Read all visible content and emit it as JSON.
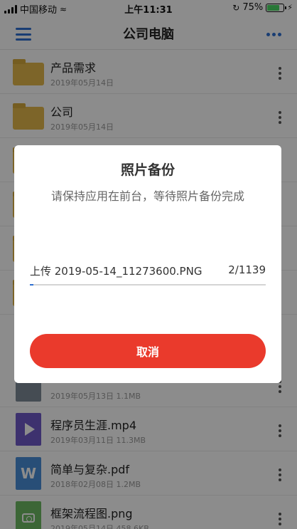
{
  "status_bar": {
    "carrier": "中国移动",
    "time": "上午11:31",
    "battery_percent": "75%",
    "battery_level": 0.75,
    "battery_color": "#4cd964"
  },
  "nav": {
    "title": "公司电脑",
    "accent_color": "#2f6fd1"
  },
  "files": [
    {
      "name": "产品需求",
      "meta": "2019年05月14日",
      "type": "folder"
    },
    {
      "name": "公司",
      "meta": "2019年05月14日",
      "type": "folder"
    },
    {
      "name": "",
      "meta": "",
      "type": "folder"
    },
    {
      "name": "",
      "meta": "",
      "type": "folder"
    },
    {
      "name": "",
      "meta": "",
      "type": "folder"
    },
    {
      "name": "",
      "meta": "",
      "type": "folder"
    },
    {
      "name": "",
      "meta": "2019年05月13日  1.1MB",
      "type": "file"
    },
    {
      "name": "程序员生涯.mp4",
      "meta": "2019年03月11日  11.3MB",
      "type": "video"
    },
    {
      "name": "简单与复杂.pdf",
      "meta": "2018年02月08日  1.2MB",
      "type": "word"
    },
    {
      "name": "框架流程图.png",
      "meta": "2019年05月14日  458.6KB",
      "type": "image"
    }
  ],
  "dialog": {
    "title": "照片备份",
    "subtitle": "请保持应用在前台，等待照片备份完成",
    "upload_label": "上传 2019-05-14_11273600.PNG",
    "upload_count": "2/1139",
    "progress": 0.015,
    "cancel_label": "取消",
    "cancel_color": "#ea3a2c"
  }
}
